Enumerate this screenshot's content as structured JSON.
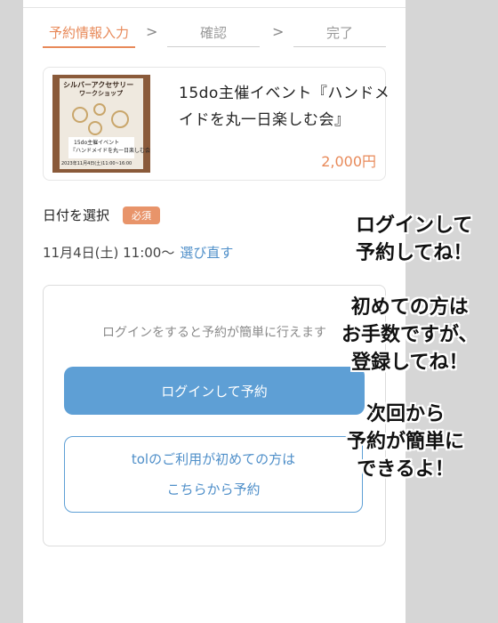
{
  "steps": {
    "input": "予約情報入力",
    "confirm": "確認",
    "done": "完了",
    "separator": ">"
  },
  "product": {
    "title": "15do主催イベント『ハンドメイドを丸一日楽しむ会』",
    "price": "2,000円",
    "flyer": {
      "line1": "シルバーアクセサリー",
      "line2": "ワークショップ",
      "band1": "15do主催イベント",
      "band2": "『ハンドメイドを丸一日楽しむ会』",
      "date": "2023年11月4日(土)11:00~16:00"
    }
  },
  "date_section": {
    "label": "日付を選択",
    "required_badge": "必須",
    "selected": "11月4日(土) 11:00〜",
    "reselect_link": "選び直す"
  },
  "login_box": {
    "hint": "ログインをすると予約が簡単に行えます",
    "login_button": "ログインして予約",
    "first_time_line1": "tolのご利用が初めての方は",
    "first_time_line2": "こちらから予約"
  },
  "annotations": {
    "a1_line1": "ログインして",
    "a1_line2": "予約してね！",
    "a2_line1": "初めての方は",
    "a2_line2": "お手数ですが、",
    "a2_line3": "登録してね！",
    "a3_line1": "次回から",
    "a3_line2": "予約が簡単に",
    "a3_line3": "できるよ！"
  },
  "colors": {
    "accent": "#e88a5a",
    "primary": "#5e9fd5",
    "link": "#4f8fc9"
  }
}
